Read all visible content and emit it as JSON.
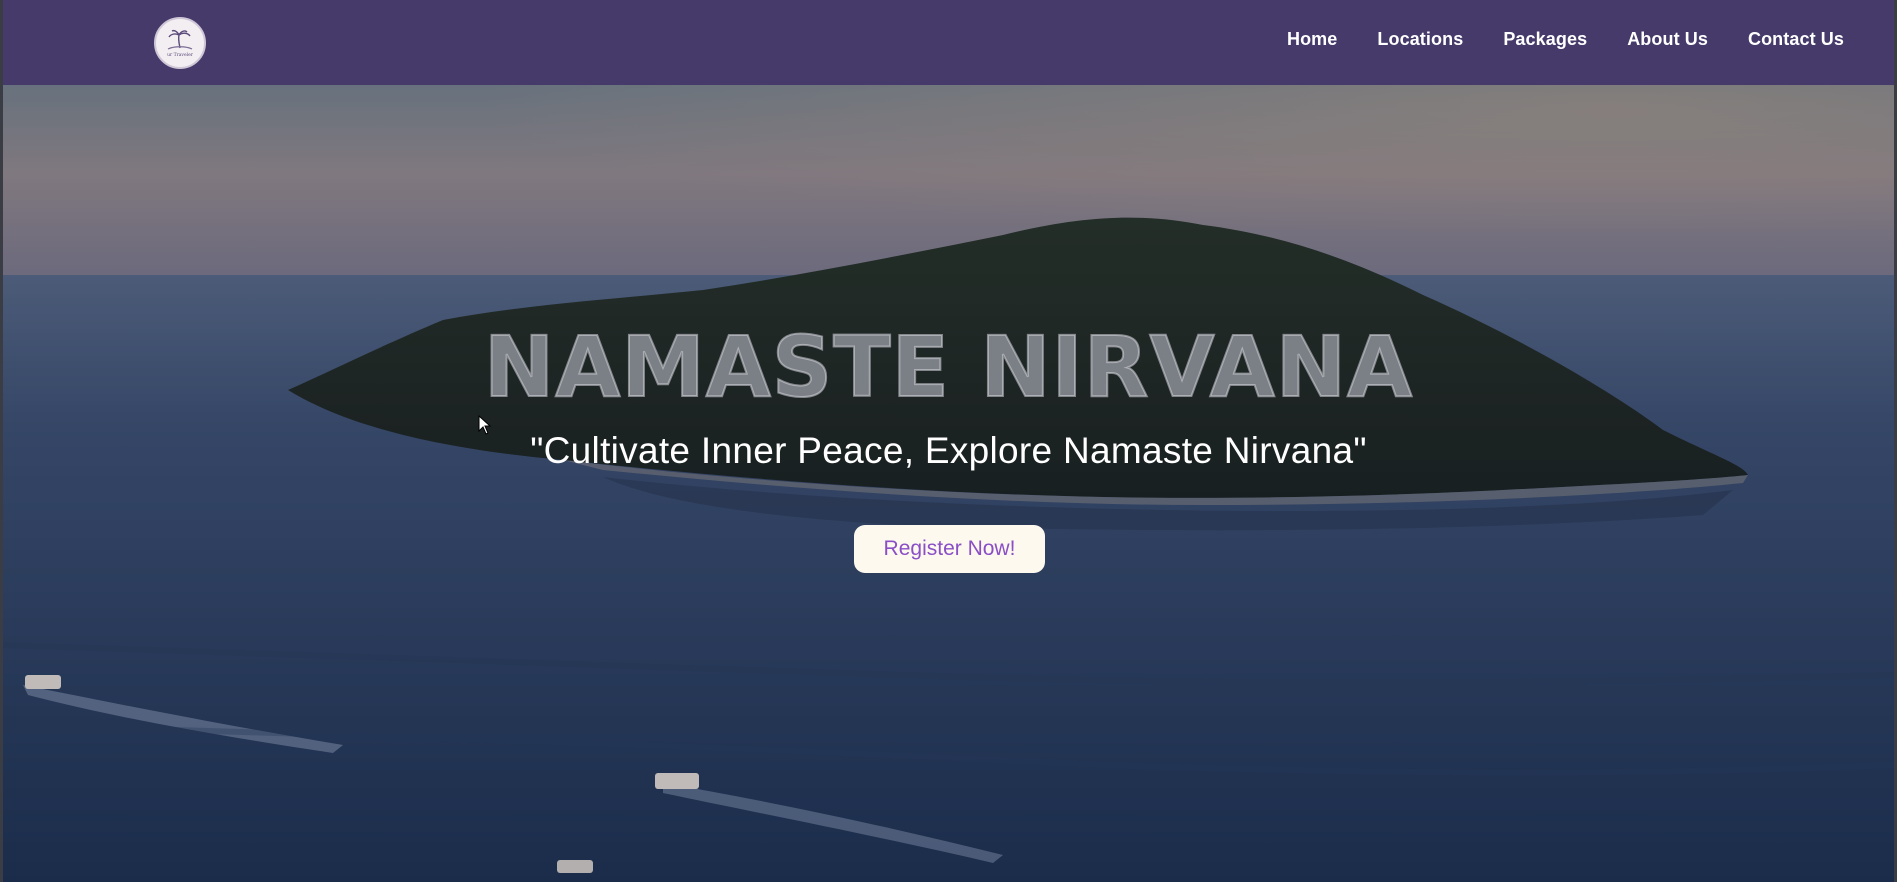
{
  "nav": {
    "logo_text": "ur Traveler",
    "links": [
      {
        "label": "Home"
      },
      {
        "label": "Locations"
      },
      {
        "label": "Packages"
      },
      {
        "label": "About Us"
      },
      {
        "label": "Contact Us"
      }
    ]
  },
  "hero": {
    "title": "NAMASTE NIRVANA",
    "tagline": "\"Cultivate Inner Peace, Explore Namaste Nirvana\"",
    "cta_label": "Register Now!"
  },
  "colors": {
    "nav_bg": "#463a6b",
    "cta_bg": "#fdf9ee",
    "cta_text": "#8a4fc7"
  }
}
